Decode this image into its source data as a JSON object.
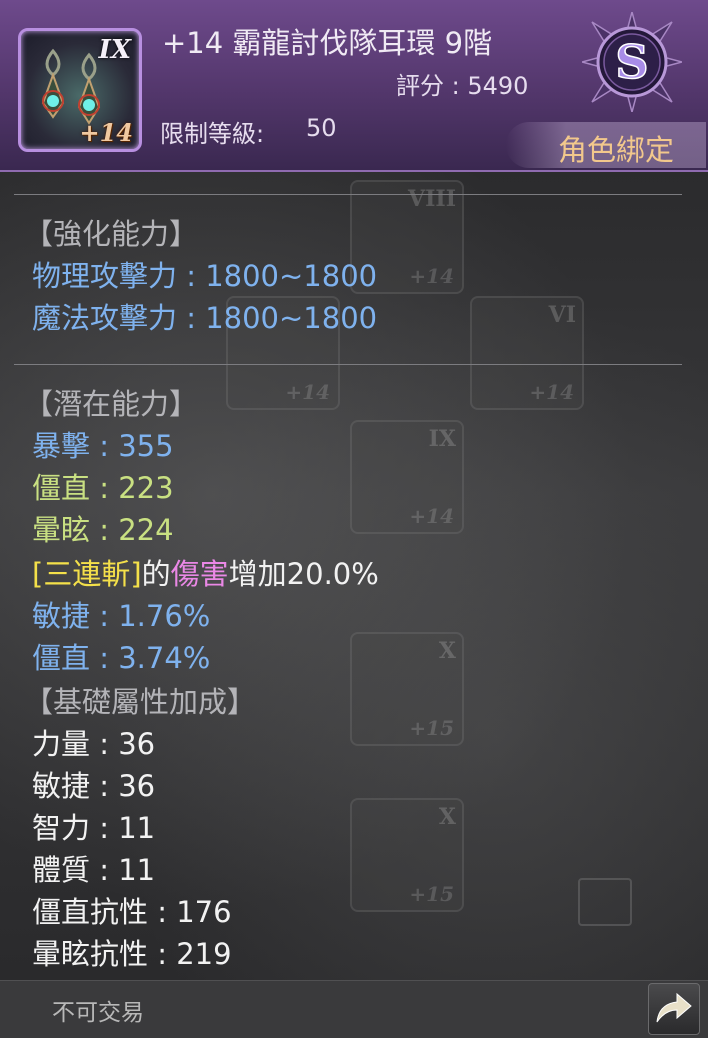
{
  "item": {
    "name": "+14 霸龍討伐隊耳環 9階",
    "score": "評分 : 5490",
    "level_label": "限制等級:",
    "level_value": "50",
    "icon_tier": "IX",
    "icon_enhance": "+14",
    "grade": "S",
    "bind": "角色綁定"
  },
  "enhance": {
    "header": "【強化能力】",
    "lines": [
      "物理攻擊力 : 1800~1800",
      "魔法攻擊力 : 1800~1800"
    ]
  },
  "potential": {
    "header": "【潛在能力】",
    "critical": "暴擊 : 355",
    "stiff": "僵直 : 223",
    "stun": "暈眩 : 224",
    "skill_bracket": "[三連斬]",
    "skill_of": "的",
    "skill_damage": "傷害",
    "skill_increase": "增加20.0%",
    "agility_pct": "敏捷 : 1.76%",
    "stiff_pct": "僵直 : 3.74%"
  },
  "base": {
    "header": "【基礎屬性加成】",
    "lines": [
      "力量 : 36",
      "敏捷 : 36",
      "智力 : 11",
      "體質 : 11",
      "僵直抗性 : 176",
      "暈眩抗性 : 219"
    ]
  },
  "footer": {
    "tradable": "不可交易"
  },
  "background_tiles": [
    {
      "tier": "VIII",
      "enhance": "+14"
    },
    {
      "tier": "VI",
      "enhance": "+14"
    },
    {
      "tier": "",
      "enhance": "+14"
    },
    {
      "tier": "IX",
      "enhance": "+14"
    },
    {
      "tier": "X",
      "enhance": "+15"
    },
    {
      "tier": "X",
      "enhance": "+15"
    }
  ],
  "colors": {
    "header_purple": "#6e4a8c",
    "blue_stat": "#7fb2ee",
    "green_stat": "#c9e082",
    "skill_yellow": "#f4e04a",
    "damage_pink": "#ea88e6",
    "bind_gold": "#f2c88c"
  }
}
